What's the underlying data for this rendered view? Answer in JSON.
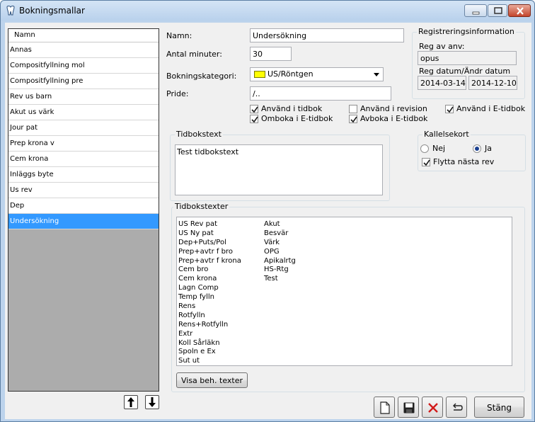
{
  "window": {
    "title": "Bokningsmallar"
  },
  "list": {
    "header": "Namn",
    "items": [
      "Annas",
      "Compositfyllning mol",
      "Compositfyllning pre",
      "Rev us barn",
      "Akut us värk",
      "Jour pat",
      "Prep krona v",
      "Cem krona",
      "Inläggs byte",
      "Us rev",
      "Dep",
      "Undersökning"
    ],
    "selected_index": 11
  },
  "form": {
    "namn_label": "Namn:",
    "namn_value": "Undersökning",
    "minuter_label": "Antal minuter:",
    "minuter_value": "30",
    "kategori_label": "Bokningskategori:",
    "kategori_value": "US/Röntgen",
    "kategori_color": "#ffff00",
    "pride_label": "Pride:",
    "pride_value": "/.."
  },
  "checkboxes": {
    "anvand_tidbok": {
      "label": "Använd i tidbok",
      "checked": true
    },
    "omboka_etidbok": {
      "label": "Omboka i E-tidbok",
      "checked": true
    },
    "anvand_revision": {
      "label": "Använd i revision",
      "checked": false
    },
    "avboka_etidbok": {
      "label": "Avboka i E-tidbok",
      "checked": true
    },
    "anvand_etidbok": {
      "label": "Använd i E-tidbok",
      "checked": true
    }
  },
  "registrering": {
    "title": "Registreringsinformation",
    "reg_av_label": "Reg av anv:",
    "reg_av_value": "opus",
    "datum_label": "Reg datum/Ändr datum",
    "reg_datum": "2014-03-14",
    "andr_datum": "2014-12-10"
  },
  "tidbokstext": {
    "title": "Tidbokstext",
    "value": "Test tidbokstext"
  },
  "kallelsekort": {
    "title": "Kallelsekort",
    "nej_label": "Nej",
    "ja_label": "Ja",
    "selected": "Ja",
    "flytta_label": "Flytta nästa rev",
    "flytta_checked": true
  },
  "tidbokstexter": {
    "title": "Tidbokstexter",
    "col1": [
      "US Rev pat",
      "US Ny pat",
      "Dep+Puts/Pol",
      "Prep+avtr f bro",
      "Prep+avtr f krona",
      "Cem bro",
      "Cem krona",
      "Lagn Comp",
      "Temp fylln",
      "Rens",
      "Rotfylln",
      "Rens+Rotfylln",
      "Extr",
      "Koll Sårläkn",
      "Spoln e Ex",
      "Sut ut"
    ],
    "col2": [
      "Akut",
      "Besvär",
      "Värk",
      "OPG",
      "Apikalrtg",
      "HS-Rtg",
      "Test"
    ],
    "visa_button": "Visa beh. texter"
  },
  "footer": {
    "stang_button": "Stäng"
  },
  "icons": [
    "app-tooth-icon",
    "minimize-icon",
    "maximize-icon",
    "close-icon",
    "arrow-up-icon",
    "arrow-down-icon",
    "new-document-icon",
    "save-disk-icon",
    "delete-x-icon",
    "undo-icon",
    "checkmark-icon",
    "dropdown-arrow-icon"
  ]
}
